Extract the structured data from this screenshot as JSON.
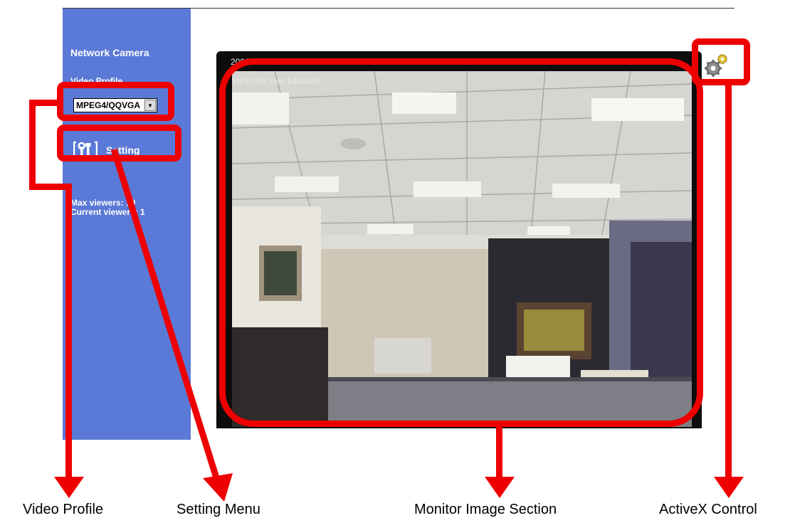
{
  "sidebar": {
    "title": "Network Camera",
    "video_profile_label": "Video Profile",
    "video_profile_value": "MPEG4/QQVGA",
    "setting_label": "Setting",
    "max_viewers": "Max viewers: 10",
    "current_viewers": "Current viewers: 1"
  },
  "monitor": {
    "timestamp": "2006/09/15 13:47:08",
    "resolution": "MPEG4V Res 640x480"
  },
  "annotations": {
    "video_profile": "Video Profile",
    "setting_menu": "Setting Menu",
    "monitor_image_section": "Monitor Image Section",
    "activex_control": "ActiveX Control"
  },
  "colors": {
    "sidebar": "#5b79d6",
    "annotation": "#ee0000",
    "monitor_frame": "#0d0d0d"
  },
  "icons": {
    "setting": "tools-icon",
    "activex": "gears-icon",
    "profile_dropdown": "chevron-down-icon"
  }
}
